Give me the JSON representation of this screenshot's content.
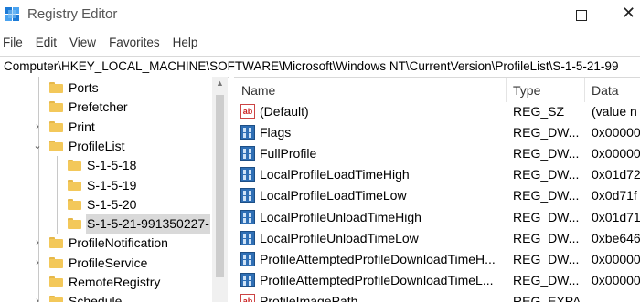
{
  "window": {
    "title": "Registry Editor"
  },
  "menu": [
    "File",
    "Edit",
    "View",
    "Favorites",
    "Help"
  ],
  "address": "Computer\\HKEY_LOCAL_MACHINE\\SOFTWARE\\Microsoft\\Windows NT\\CurrentVersion\\ProfileList\\S-1-5-21-99",
  "tree": {
    "items": [
      {
        "label": "Ports",
        "expander": ""
      },
      {
        "label": "Prefetcher",
        "expander": ""
      },
      {
        "label": "Print",
        "expander": "›"
      },
      {
        "label": "ProfileList",
        "expander": "⌄"
      },
      {
        "label": "S-1-5-18",
        "expander": ""
      },
      {
        "label": "S-1-5-19",
        "expander": ""
      },
      {
        "label": "S-1-5-20",
        "expander": ""
      },
      {
        "label": "S-1-5-21-991350227-",
        "expander": "",
        "selected": true
      },
      {
        "label": "ProfileNotification",
        "expander": "›"
      },
      {
        "label": "ProfileService",
        "expander": "›"
      },
      {
        "label": "RemoteRegistry",
        "expander": ""
      },
      {
        "label": "Schedule",
        "expander": "›"
      }
    ]
  },
  "list": {
    "headers": {
      "name": "Name",
      "type": "Type",
      "data": "Data"
    },
    "rows": [
      {
        "icon": "string-value-icon",
        "name": "(Default)",
        "type": "REG_SZ",
        "data": "(value n"
      },
      {
        "icon": "binary-value-icon",
        "name": "Flags",
        "type": "REG_DW...",
        "data": "0x00000"
      },
      {
        "icon": "binary-value-icon",
        "name": "FullProfile",
        "type": "REG_DW...",
        "data": "0x00000"
      },
      {
        "icon": "binary-value-icon",
        "name": "LocalProfileLoadTimeHigh",
        "type": "REG_DW...",
        "data": "0x01d72"
      },
      {
        "icon": "binary-value-icon",
        "name": "LocalProfileLoadTimeLow",
        "type": "REG_DW...",
        "data": "0x0d71f"
      },
      {
        "icon": "binary-value-icon",
        "name": "LocalProfileUnloadTimeHigh",
        "type": "REG_DW...",
        "data": "0x01d71"
      },
      {
        "icon": "binary-value-icon",
        "name": "LocalProfileUnloadTimeLow",
        "type": "REG_DW...",
        "data": "0xbe646"
      },
      {
        "icon": "binary-value-icon",
        "name": "ProfileAttemptedProfileDownloadTimeH...",
        "type": "REG_DW...",
        "data": "0x00000"
      },
      {
        "icon": "binary-value-icon",
        "name": "ProfileAttemptedProfileDownloadTimeL...",
        "type": "REG_DW...",
        "data": "0x00000"
      },
      {
        "icon": "string-value-icon",
        "name": "ProfileImagePath",
        "type": "REG_EXPA...",
        "data": ""
      }
    ]
  },
  "colors": {
    "folder": "#f3c85a",
    "selected": "#d9d9d9",
    "reg-icon": "#2f6fb5"
  }
}
